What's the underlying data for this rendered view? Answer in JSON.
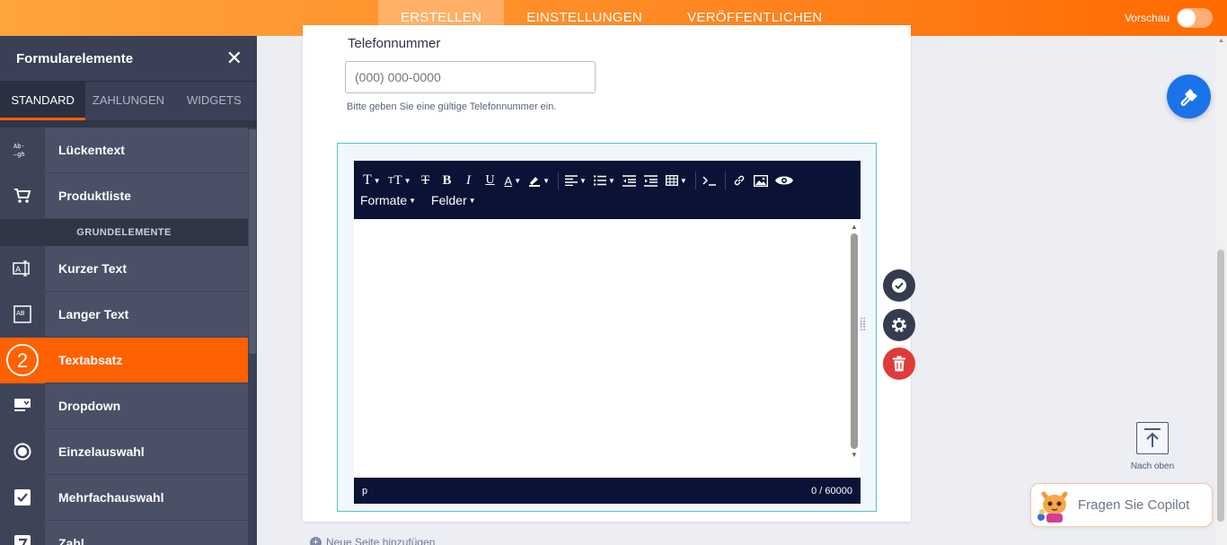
{
  "topbar": {
    "tabs": [
      {
        "label": "ERSTELLEN",
        "active": true
      },
      {
        "label": "EINSTELLUNGEN",
        "active": false
      },
      {
        "label": "VERÖFFENTLICHEN",
        "active": false
      }
    ],
    "preview_label": "Vorschau",
    "preview_enabled": false
  },
  "sidebar": {
    "title": "Formularelemente",
    "tabs": [
      {
        "label": "STANDARD",
        "active": true
      },
      {
        "label": "ZAHLUNGEN",
        "active": false
      },
      {
        "label": "WIDGETS",
        "active": false
      }
    ],
    "items_top": [
      {
        "label": "Lückentext",
        "icon": "fill-in-blank-icon",
        "icon_text": "Ab-\n—gh"
      },
      {
        "label": "Produktliste",
        "icon": "cart-icon"
      }
    ],
    "section_label": "GRUNDELEMENTE",
    "items": [
      {
        "label": "Kurzer Text",
        "icon": "short-text-icon"
      },
      {
        "label": "Langer Text",
        "icon": "long-text-icon"
      },
      {
        "label": "Textabsatz",
        "icon": "paragraph-icon",
        "badge": "2",
        "active": true
      },
      {
        "label": "Dropdown",
        "icon": "dropdown-icon"
      },
      {
        "label": "Einzelauswahl",
        "icon": "radio-icon"
      },
      {
        "label": "Mehrfachauswahl",
        "icon": "checkbox-icon"
      },
      {
        "label": "Zahl",
        "icon": "number-icon"
      }
    ]
  },
  "form": {
    "phone_label": "Telefonnummer",
    "phone_placeholder": "(000) 000-0000",
    "phone_hint": "Bitte geben Sie eine gültige Telefonnummer ein.",
    "toolbar_row2": [
      "Formate",
      "Felder"
    ],
    "status_path": "p",
    "char_count": "0 / 60000",
    "add_page": "Neue Seite hinzufügen"
  },
  "right": {
    "to_top_label": "Nach oben",
    "copilot_label": "Fragen Sie Copilot"
  },
  "colors": {
    "accent": "#ff6100",
    "toolbar_bg": "#0a1235",
    "delete": "#e03a3a",
    "paint_button": "#1a73e8"
  }
}
